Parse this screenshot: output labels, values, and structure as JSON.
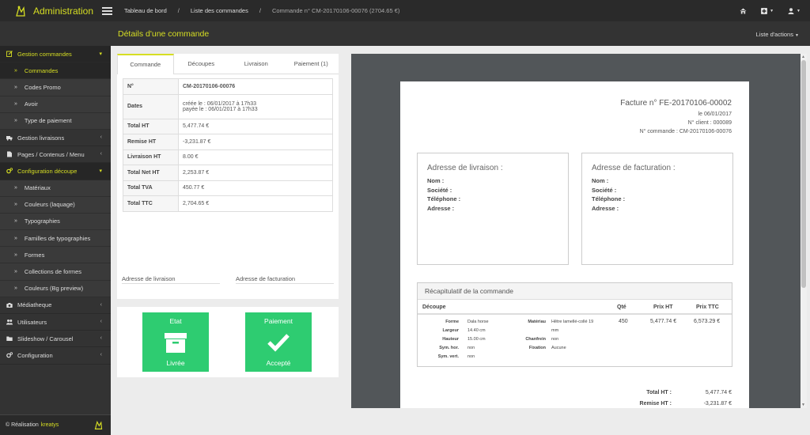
{
  "app": {
    "title": "Administration"
  },
  "breadcrumb": {
    "items": [
      "Tableau de bord",
      "Liste des commandes"
    ],
    "current": "Commande n° CM-20170106-00076 (2704.65 €)"
  },
  "header": {
    "title": "Détails d'une commande",
    "actions_label": "Liste d'actions"
  },
  "sidebar": {
    "groups": [
      {
        "label": "Gestion commandes",
        "icon": "edit-icon",
        "active": true
      },
      {
        "label": "Gestion livraisons",
        "icon": "truck-icon"
      },
      {
        "label": "Pages / Contenus / Menu",
        "icon": "file-icon"
      },
      {
        "label": "Configuration découpe",
        "icon": "cogs-icon",
        "active": true
      },
      {
        "label": "Médiatheque",
        "icon": "camera-icon"
      },
      {
        "label": "Utilisateurs",
        "icon": "users-icon"
      },
      {
        "label": "Slideshow / Carousel",
        "icon": "folder-icon"
      },
      {
        "label": "Configuration",
        "icon": "cogs-icon"
      }
    ],
    "orders_items": [
      "Commandes",
      "Codes Promo",
      "Avoir",
      "Type de paiement"
    ],
    "cut_items": [
      "Matériaux",
      "Couleurs (laquage)",
      "Typographies",
      "Familles de typographies",
      "Formes",
      "Collections de formes",
      "Couleurs (Bg preview)"
    ],
    "footer_label": "Réalisation",
    "footer_link": "kreatys"
  },
  "tabs": [
    "Commande",
    "Découpes",
    "Livraison",
    "Paiement (1)"
  ],
  "order": {
    "rows": [
      {
        "k": "N°",
        "v": "CM-20170106-00076"
      },
      {
        "k": "Dates",
        "v1": "créée le : 06/01/2017 à 17h33",
        "v2": "payée le : 06/01/2017 à 17h33"
      },
      {
        "k": "Total HT",
        "v": "5,477.74 €"
      },
      {
        "k": "Remise HT",
        "v": "-3,231.87 €"
      },
      {
        "k": "Livraison HT",
        "v": "8.00 €"
      },
      {
        "k": "Total Net HT",
        "v": "2,253.87 €"
      },
      {
        "k": "Total TVA",
        "v": "450.77 €"
      },
      {
        "k": "Total TTC",
        "v": "2,704.65 €"
      }
    ],
    "address_delivery": "Adresse de livraison",
    "address_billing": "Adresse de facturation"
  },
  "status": {
    "etat": {
      "title": "Etat",
      "value": "Livrée"
    },
    "paiement": {
      "title": "Paiement",
      "value": "Accepté"
    }
  },
  "invoice": {
    "title": "Facture n° FE-20170106-00002",
    "date": "le 06/01/2017",
    "client": "N° client : 000089",
    "order": "N° commande : CM-20170106-00076",
    "delivery_title": "Adresse de livraison :",
    "billing_title": "Adresse de facturation :",
    "fields": [
      "Nom :",
      "Société :",
      "Téléphone :",
      "Adresse :"
    ],
    "recap_title": "Récapitulatif de la commande",
    "cols": {
      "decoupe": "Découpe",
      "qte": "Qté",
      "prix_ht": "Prix HT",
      "prix_ttc": "Prix TTC"
    },
    "line": {
      "specs_left": [
        {
          "k": "Forme",
          "v": "Dala horse"
        },
        {
          "k": "Largeur",
          "v": "14.40 cm"
        },
        {
          "k": "Hauteur",
          "v": "15.00 cm"
        },
        {
          "k": "Sym. hor.",
          "v": "non"
        },
        {
          "k": "Sym. vert.",
          "v": "non"
        }
      ],
      "specs_right": [
        {
          "k": "Matériau",
          "v": "Hêtre lamellé-collé 19",
          "v2": "mm"
        },
        {
          "k": "Chanfrein",
          "v": "non"
        },
        {
          "k": "Fixation",
          "v": "Aucune"
        }
      ],
      "qte": "450",
      "prix_ht": "5,477.74 €",
      "prix_ttc": "6,573.29 €"
    },
    "totals": [
      {
        "k": "Total HT :",
        "v": "5,477.74 €"
      },
      {
        "k": "Remise HT :",
        "v": "-3,231.87 €"
      }
    ]
  },
  "colors": {
    "accent": "#d6de23",
    "dark": "#333333",
    "success": "#2ecc71"
  }
}
